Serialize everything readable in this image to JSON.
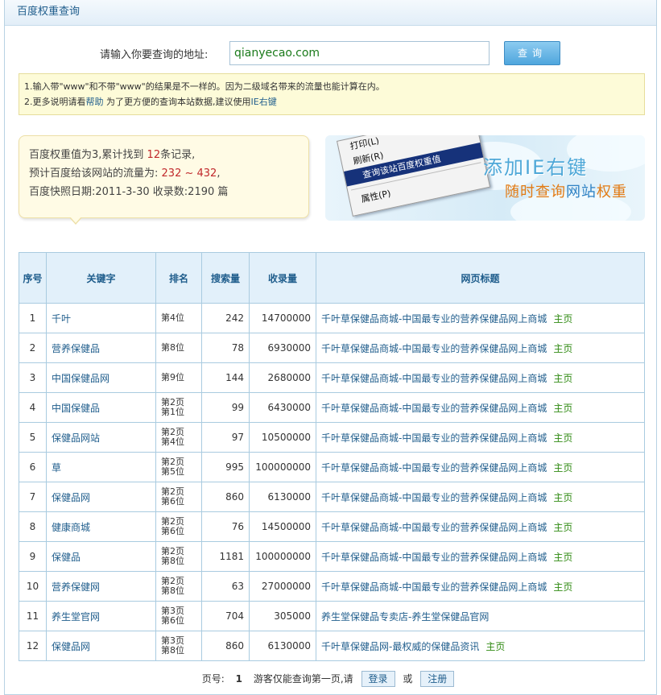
{
  "header": {
    "title": "百度权重查询"
  },
  "query": {
    "label": "请输入你要查询的地址:",
    "value": "qianyecao.com",
    "button": "查询"
  },
  "notice": {
    "line1": "1.输入带\"www\"和不带\"www\"的结果是不一样的。因为二级域名带来的流量也能计算在内。",
    "line2_prefix": "2.更多说明请看",
    "help_link": "帮助",
    "line2_mid": "为了更方便的查询本站数据,建议使用",
    "ie_link": "IE右键"
  },
  "summary": {
    "weight_prefix": "百度权重值为3,累计找到",
    "record_count": "12",
    "record_suffix": "条记录,",
    "traffic_prefix": "预计百度给该网站的流量为:",
    "traffic_value": "232 ~ 432",
    "traffic_suffix": ",",
    "snapshot": "百度快照日期:2011-3-30 收录数:2190 篇"
  },
  "banner": {
    "menu_items": [
      "打印(L)",
      "刷新(R)",
      "查询该站百度权重值",
      "属性(P)"
    ],
    "title": "添加IE右键",
    "subtitle_a": "随时查询",
    "subtitle_b": "网站",
    "subtitle_c": "权重"
  },
  "table": {
    "headers": [
      "序号",
      "关键字",
      "排名",
      "搜索量",
      "收录量",
      "网页标题"
    ],
    "home_label": "主页",
    "rows": [
      {
        "no": "1",
        "keyword": "千叶",
        "rank1": "第4位",
        "rank2": "",
        "search": "242",
        "indexed": "14700000",
        "title": "千叶草保健品商城-中国最专业的营养保健品网上商城",
        "home": true
      },
      {
        "no": "2",
        "keyword": "营养保健品",
        "rank1": "第8位",
        "rank2": "",
        "search": "78",
        "indexed": "6930000",
        "title": "千叶草保健品商城-中国最专业的营养保健品网上商城",
        "home": true
      },
      {
        "no": "3",
        "keyword": "中国保健品网",
        "rank1": "第9位",
        "rank2": "",
        "search": "144",
        "indexed": "2680000",
        "title": "千叶草保健品商城-中国最专业的营养保健品网上商城",
        "home": true
      },
      {
        "no": "4",
        "keyword": "中国保健品",
        "rank1": "第2页",
        "rank2": "第1位",
        "search": "99",
        "indexed": "6430000",
        "title": "千叶草保健品商城-中国最专业的营养保健品网上商城",
        "home": true
      },
      {
        "no": "5",
        "keyword": "保健品网站",
        "rank1": "第2页",
        "rank2": "第4位",
        "search": "97",
        "indexed": "10500000",
        "title": "千叶草保健品商城-中国最专业的营养保健品网上商城",
        "home": true
      },
      {
        "no": "6",
        "keyword": "草",
        "rank1": "第2页",
        "rank2": "第5位",
        "search": "995",
        "indexed": "100000000",
        "title": "千叶草保健品商城-中国最专业的营养保健品网上商城",
        "home": true
      },
      {
        "no": "7",
        "keyword": "保健品网",
        "rank1": "第2页",
        "rank2": "第6位",
        "search": "860",
        "indexed": "6130000",
        "title": "千叶草保健品商城-中国最专业的营养保健品网上商城",
        "home": true
      },
      {
        "no": "8",
        "keyword": "健康商城",
        "rank1": "第2页",
        "rank2": "第6位",
        "search": "76",
        "indexed": "14500000",
        "title": "千叶草保健品商城-中国最专业的营养保健品网上商城",
        "home": true
      },
      {
        "no": "9",
        "keyword": "保健品",
        "rank1": "第2页",
        "rank2": "第8位",
        "search": "1181",
        "indexed": "100000000",
        "title": "千叶草保健品商城-中国最专业的营养保健品网上商城",
        "home": true
      },
      {
        "no": "10",
        "keyword": "营养保健网",
        "rank1": "第2页",
        "rank2": "第8位",
        "search": "63",
        "indexed": "27000000",
        "title": "千叶草保健品商城-中国最专业的营养保健品网上商城",
        "home": true
      },
      {
        "no": "11",
        "keyword": "养生堂官网",
        "rank1": "第3页",
        "rank2": "第6位",
        "search": "704",
        "indexed": "305000",
        "title": "养生堂保健品专卖店-养生堂保健品官网",
        "home": false
      },
      {
        "no": "12",
        "keyword": "保健品网",
        "rank1": "第3页",
        "rank2": "第8位",
        "search": "860",
        "indexed": "6130000",
        "title": "千叶草保健品网-最权威的保健品资讯",
        "home": true
      }
    ]
  },
  "pager": {
    "label": "页号:",
    "page": "1",
    "note": "游客仅能查询第一页,请",
    "login": "登录",
    "or": "或",
    "register": "注册"
  }
}
